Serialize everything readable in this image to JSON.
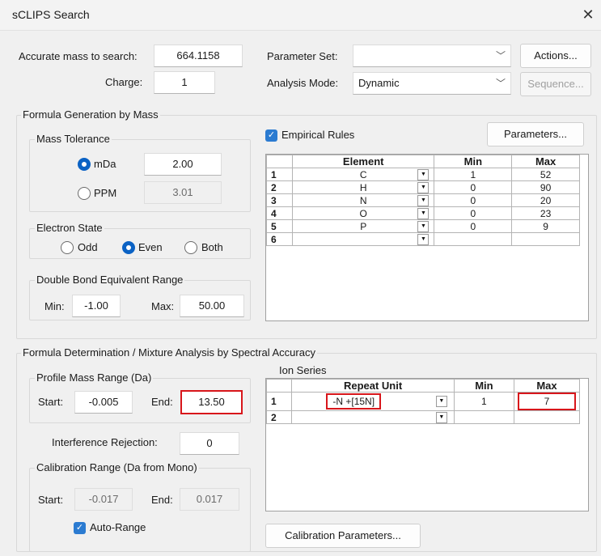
{
  "window": {
    "title": "sCLIPS Search"
  },
  "accurate_mass": {
    "label": "Accurate mass to search:",
    "value": "664.1158"
  },
  "charge": {
    "label": "Charge:",
    "value": "1"
  },
  "parameter_set": {
    "label": "Parameter Set:",
    "value": ""
  },
  "analysis_mode": {
    "label": "Analysis Mode:",
    "value": "Dynamic"
  },
  "buttons": {
    "actions": "Actions...",
    "sequence": "Sequence...",
    "parameters": "Parameters...",
    "calibration_parameters": "Calibration Parameters..."
  },
  "formula_generation": {
    "title": "Formula Generation by Mass",
    "mass_tolerance": {
      "title": "Mass Tolerance",
      "mda_label": "mDa",
      "mda_value": "2.00",
      "mda_selected": true,
      "ppm_label": "PPM",
      "ppm_value": "3.01"
    },
    "electron_state": {
      "title": "Electron State",
      "odd": "Odd",
      "even": "Even",
      "both": "Both",
      "selected": "Even"
    },
    "dbe_range": {
      "title": "Double Bond Equivalent Range",
      "min_label": "Min:",
      "min_value": "-1.00",
      "max_label": "Max:",
      "max_value": "50.00"
    },
    "empirical_rules": {
      "label": "Empirical Rules",
      "checked": true
    },
    "element_table": {
      "headers": [
        "Element",
        "Min",
        "Max"
      ],
      "rows": [
        {
          "n": "1",
          "element": "C",
          "min": "1",
          "max": "52"
        },
        {
          "n": "2",
          "element": "H",
          "min": "0",
          "max": "90"
        },
        {
          "n": "3",
          "element": "N",
          "min": "0",
          "max": "20"
        },
        {
          "n": "4",
          "element": "O",
          "min": "0",
          "max": "23"
        },
        {
          "n": "5",
          "element": "P",
          "min": "0",
          "max": "9"
        },
        {
          "n": "6",
          "element": "",
          "min": "",
          "max": ""
        }
      ]
    }
  },
  "formula_determination": {
    "title": "Formula Determination / Mixture Analysis by Spectral Accuracy",
    "profile_mass_range": {
      "title": "Profile Mass Range (Da)",
      "start_label": "Start:",
      "start_value": "-0.005",
      "end_label": "End:",
      "end_value": "13.50"
    },
    "interference_rejection": {
      "label": "Interference Rejection:",
      "value": "0"
    },
    "calibration_range": {
      "title": "Calibration Range (Da from Mono)",
      "start_label": "Start:",
      "start_value": "-0.017",
      "end_label": "End:",
      "end_value": "0.017"
    },
    "auto_range": {
      "label": "Auto-Range",
      "checked": true
    },
    "ion_series": {
      "title": "Ion Series",
      "headers": [
        "Repeat Unit",
        "Min",
        "Max"
      ],
      "rows": [
        {
          "n": "1",
          "unit": "-N +[15N]",
          "min": "1",
          "max": "7"
        },
        {
          "n": "2",
          "unit": "",
          "min": "",
          "max": ""
        }
      ]
    }
  },
  "icons": {
    "close": "close-icon",
    "dropdown": "chevron-down-icon",
    "check": "checkmark-icon"
  },
  "colors": {
    "accent": "#0b62c4",
    "highlight": "#d8161b"
  }
}
